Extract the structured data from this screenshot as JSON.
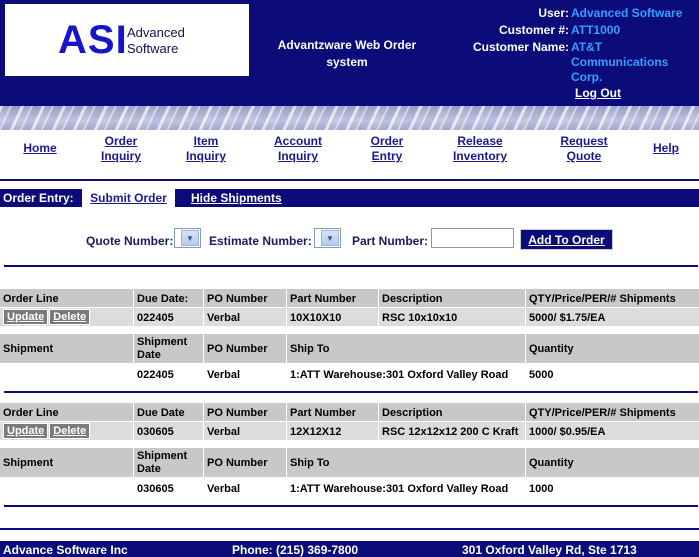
{
  "header": {
    "logo_text": "ASI",
    "logo_sub_line1": "Advanced",
    "logo_sub_line2": "Software",
    "app_title_line1": "Advantzware Web Order",
    "app_title_line2": "system",
    "user_label": "User:",
    "user_value": "Advanced Software",
    "customer_num_label": "Customer #:",
    "customer_num_value": "ATT1000",
    "customer_name_label": "Customer Name:",
    "customer_name_line1": "AT&T",
    "customer_name_line2": "Communications",
    "customer_name_line3": "Corp.",
    "logout": "Log Out"
  },
  "nav": {
    "home": "Home",
    "order_inquiry_1": "Order",
    "order_inquiry_2": "Inquiry",
    "item_inquiry_1": "Item",
    "item_inquiry_2": "Inquiry",
    "account_inquiry_1": "Account",
    "account_inquiry_2": "Inquiry",
    "order_entry_1": "Order",
    "order_entry_2": "Entry",
    "release_inventory_1": "Release",
    "release_inventory_2": "Inventory",
    "request_quote_1": "Request",
    "request_quote_2": "Quote",
    "help": "Help"
  },
  "order_entry": {
    "label": "Order Entry:",
    "submit": "Submit Order",
    "hide_shipments": "Hide Shipments"
  },
  "search": {
    "quote_label": "Quote Number:",
    "estimate_label": "Estimate Number:",
    "part_label": "Part Number:",
    "part_value": "",
    "add_button": "Add To Order"
  },
  "table_headers": {
    "order_line": "Order Line",
    "due_date": "Due Date:",
    "due_date_2": "Due Date",
    "po_number": "PO Number",
    "part_number": "Part Number",
    "description": "Description",
    "qty": "QTY/Price/PER/# Shipments",
    "shipment": "Shipment",
    "shipment_date_1": "Shipment",
    "shipment_date_2": "Date",
    "ship_to": "Ship To",
    "quantity": "Quantity"
  },
  "actions": {
    "update": "Update",
    "delete": "Delete"
  },
  "orders": [
    {
      "due_date": "022405",
      "po_number": "Verbal",
      "part_number": "10X10X10",
      "description": "RSC 10x10x10",
      "qty": "5000/ $1.75/EA",
      "shipment": {
        "date": "022405",
        "po_number": "Verbal",
        "ship_to": "1:ATT Warehouse:301 Oxford Valley Road",
        "quantity": "5000"
      }
    },
    {
      "due_date": "030605",
      "po_number": "Verbal",
      "part_number": "12X12X12",
      "description": "RSC 12x12x12 200 C Kraft",
      "qty": "1000/ $0.95/EA",
      "shipment": {
        "date": "030605",
        "po_number": "Verbal",
        "ship_to": "1:ATT Warehouse:301 Oxford Valley Road",
        "quantity": "1000"
      }
    }
  ],
  "footer": {
    "company": "Advance Software Inc",
    "phone": "Phone: (215) 369-7800",
    "address": "301 Oxford Valley Rd, Ste 1713"
  },
  "colors": {
    "header_bg": "#0b0b7a",
    "link_value": "#33a0ff",
    "nav_link": "#1a1a8e",
    "table_header": "#c8c8c8"
  }
}
